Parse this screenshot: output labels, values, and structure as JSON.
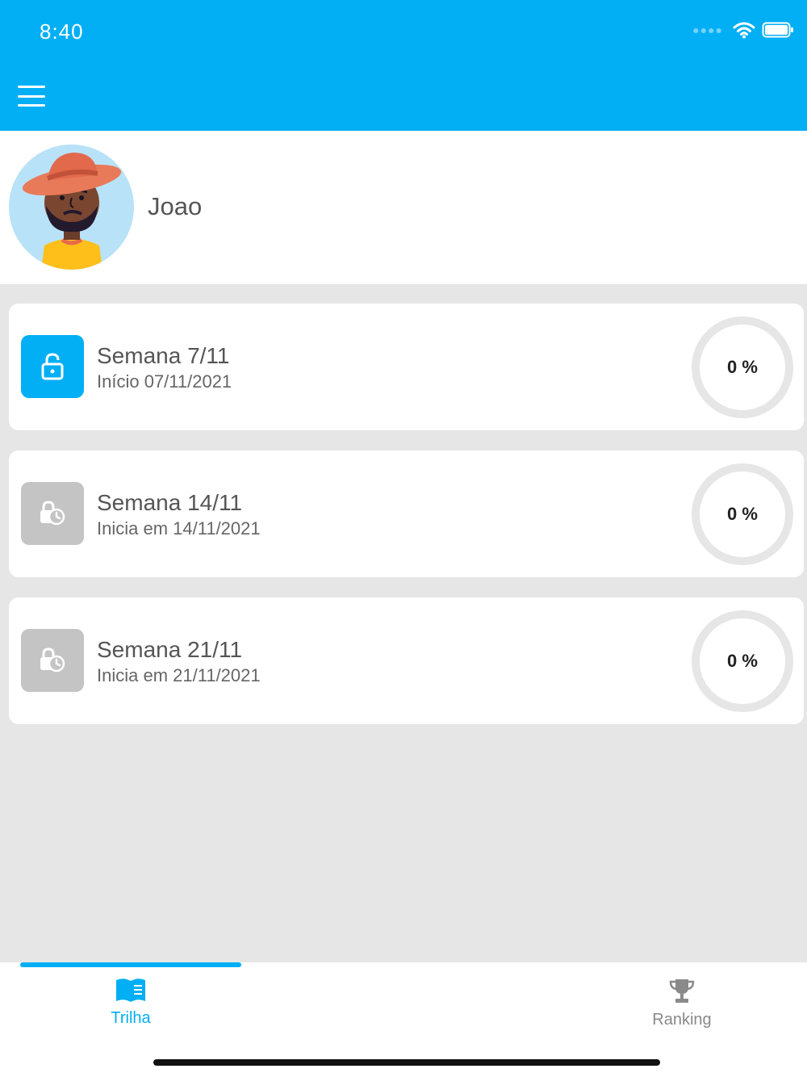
{
  "status_bar": {
    "time": "8:40"
  },
  "profile": {
    "name": "Joao"
  },
  "weeks": [
    {
      "title": "Semana 7/11",
      "subtitle": "Início 07/11/2021",
      "progress": "0 %",
      "state": "unlocked"
    },
    {
      "title": "Semana 14/11",
      "subtitle": "Inicia em 14/11/2021",
      "progress": "0 %",
      "state": "scheduled"
    },
    {
      "title": "Semana 21/11",
      "subtitle": "Inicia em 21/11/2021",
      "progress": "0 %",
      "state": "scheduled"
    }
  ],
  "tabs": [
    {
      "label": "Trilha",
      "icon": "book-icon",
      "active": true
    },
    {
      "label": "Ranking",
      "icon": "trophy-icon",
      "active": false
    }
  ],
  "colors": {
    "accent": "#03aff4",
    "locked": "#c4c4c4",
    "background": "#e6e6e6"
  }
}
